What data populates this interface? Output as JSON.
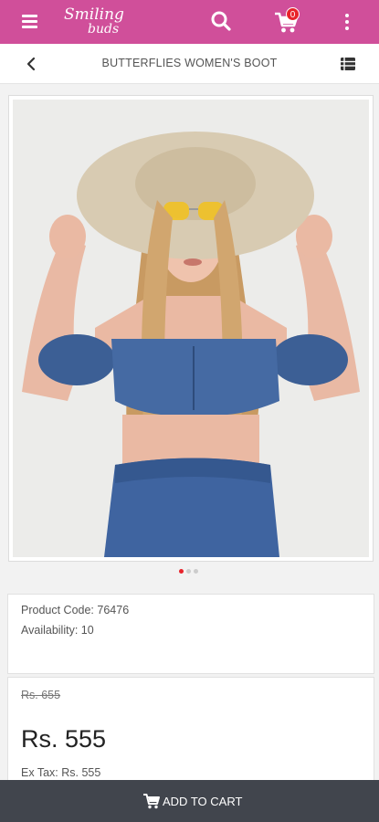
{
  "app": {
    "logo_line1": "Smiling",
    "logo_line2": "buds",
    "cart_count": "0",
    "colors": {
      "topbar": "#d04f9a",
      "badge": "#e8232b",
      "cart_bar": "#41454d"
    },
    "icons": [
      "menu-icon",
      "search-icon",
      "cart-icon",
      "more-vertical-icon"
    ]
  },
  "subheader": {
    "title": "BUTTERFLIES WOMEN'S BOOT",
    "icons": [
      "back-icon",
      "list-view-icon"
    ]
  },
  "carousel": {
    "slide_count": 3,
    "active_index": 0
  },
  "product": {
    "code_label": "Product Code: 76476",
    "availability_label": "Availability: 10",
    "old_price": "Rs. 655",
    "price": "Rs. 555",
    "ex_tax": "Ex Tax: Rs. 555"
  },
  "actions": {
    "add_to_cart": "ADD TO CART"
  }
}
